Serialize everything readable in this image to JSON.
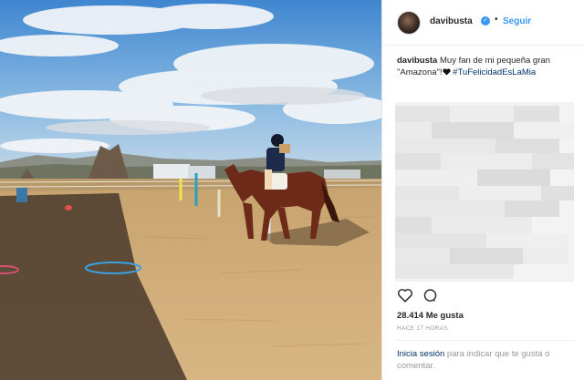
{
  "post": {
    "username": "davibusta",
    "follow_label": "Seguir",
    "separator": "•",
    "verified_icon": "verified-check-icon",
    "caption_text": "Muy fan de mi pequeña gran \"Amazona\"!",
    "caption_hashtag": "#TuFelicidadEsLaMia",
    "likes": "28.414 Me gusta",
    "time": "HACE 17 HORAS",
    "login_link": "Inicia sesión",
    "login_rest": " para indicar que te gusta o comentar."
  },
  "icons": {
    "like": "heart-outline-icon",
    "comment": "comment-bubble-icon",
    "emoji": "black-heart-emoji"
  },
  "colors": {
    "link": "#3897f0",
    "hashtag": "#003569",
    "muted": "#999999"
  }
}
